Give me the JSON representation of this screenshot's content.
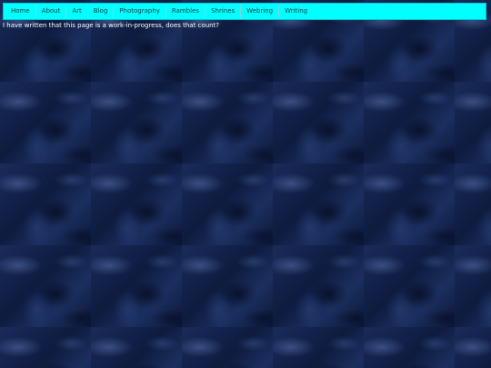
{
  "nav": {
    "items": [
      {
        "label": "Home"
      },
      {
        "label": "About"
      },
      {
        "label": "Art"
      },
      {
        "label": "Blog"
      },
      {
        "label": "Photography"
      },
      {
        "label": "Rambles"
      },
      {
        "label": "Shrines"
      },
      {
        "label": "Webring"
      },
      {
        "label": "Writing"
      }
    ]
  },
  "main": {
    "note": "I have written that this page is a work-in-progress, does that count?"
  },
  "colors": {
    "nav_background": "#00ffff",
    "page_background": "#0e1d42",
    "text": "#ffffff"
  }
}
